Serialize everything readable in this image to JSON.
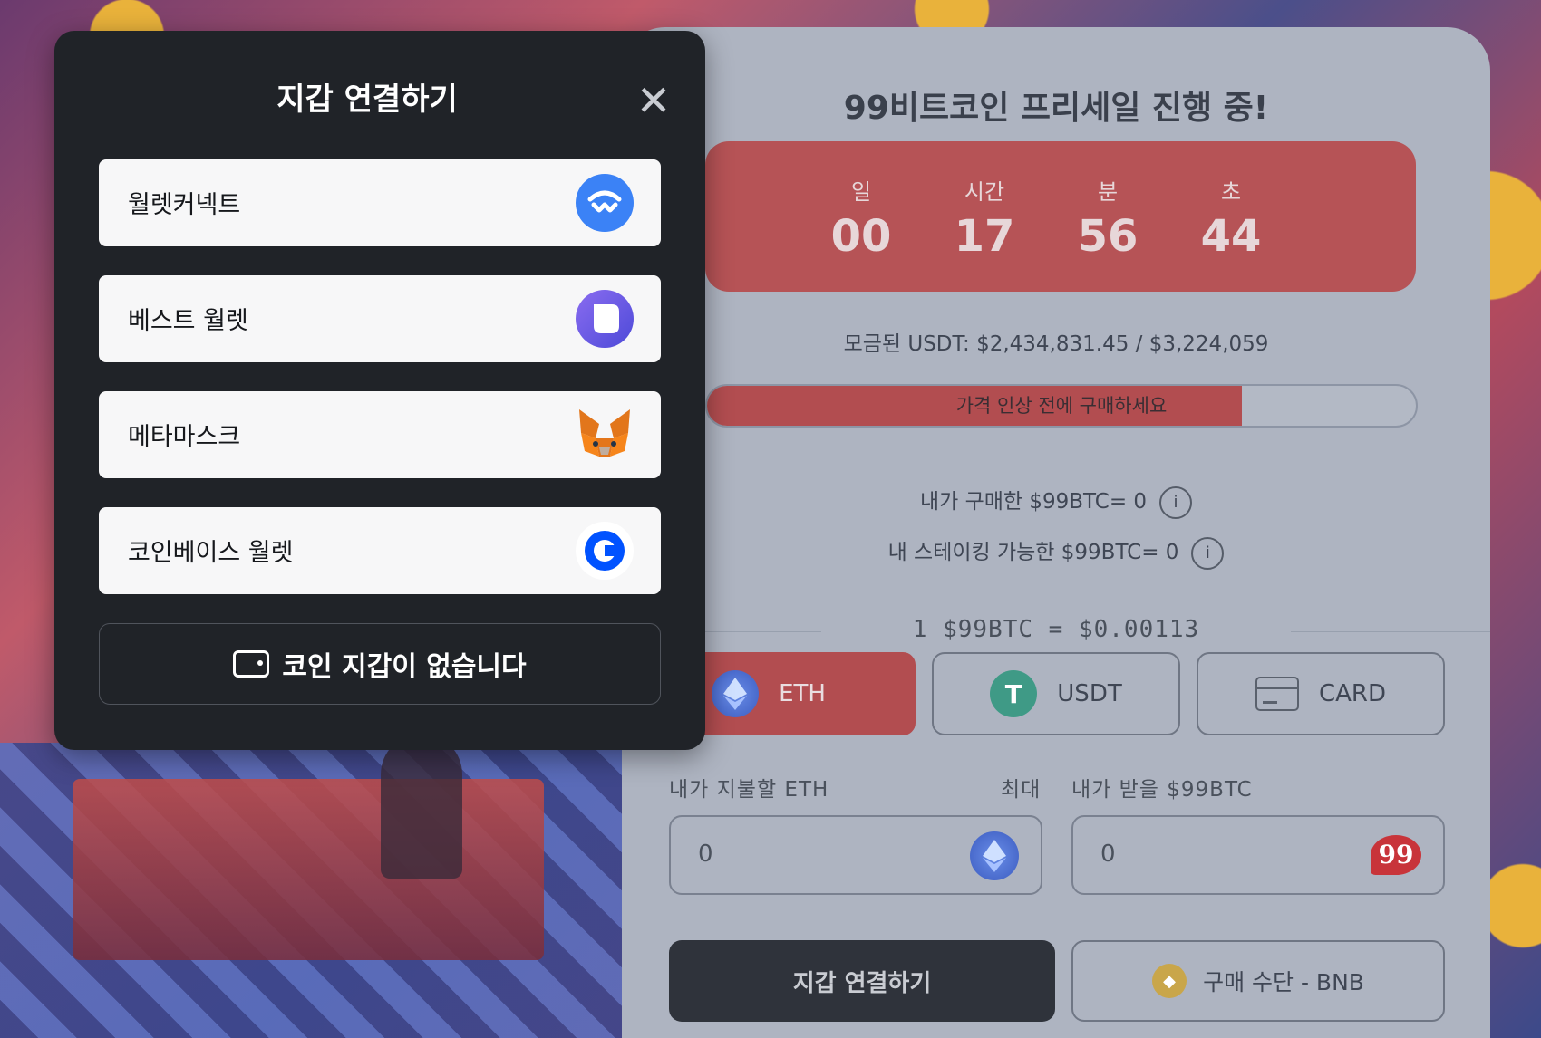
{
  "modal": {
    "title": "지갑 연결하기",
    "close_icon": "close-icon",
    "wallets": [
      {
        "label": "월렛커넥트",
        "icon": "walletconnect-icon",
        "color": "#3b82f6"
      },
      {
        "label": "베스트 월렛",
        "icon": "bestwallet-icon",
        "color": "#6d5ce8"
      },
      {
        "label": "메타마스크",
        "icon": "metamask-fox-icon",
        "color": "#e2761b"
      },
      {
        "label": "코인베이스 월렛",
        "icon": "coinbase-icon",
        "color": "#0052ff"
      }
    ],
    "no_wallet_label": "코인 지갑이 없습니다",
    "no_wallet_icon": "wallet-icon"
  },
  "presale": {
    "title": "99비트코인 프리세일 진행 중!",
    "countdown": [
      {
        "label": "일",
        "value": "00"
      },
      {
        "label": "시간",
        "value": "17"
      },
      {
        "label": "분",
        "value": "56"
      },
      {
        "label": "초",
        "value": "44"
      }
    ],
    "raised_text": "모금된 USDT: $2,434,831.45 / $3,224,059",
    "progress_fraction": 0.755,
    "progress_text": "가격 인상 전에 구매하세요",
    "my_purchased": "내가 구매한 $99BTC= 0",
    "my_stakeable": "내 스테이킹 가능한 $99BTC= 0",
    "info_glyph": "i",
    "rate": "1 $99BTC = $0.00113",
    "payment_methods": [
      {
        "label": "ETH",
        "icon": "eth-icon",
        "active": true
      },
      {
        "label": "USDT",
        "icon": "usdt-icon",
        "active": false
      },
      {
        "label": "CARD",
        "icon": "card-icon",
        "active": false
      }
    ],
    "pay_label": "내가 지불할 ETH",
    "max_label": "최대",
    "receive_label": "내가 받을 $99BTC",
    "pay_value": "0",
    "receive_value": "0",
    "receive_icon_text": "99",
    "connect_button": "지갑 연결하기",
    "buy_with_label": "구매 수단 - BNB",
    "accent_color": "#b24d50"
  }
}
